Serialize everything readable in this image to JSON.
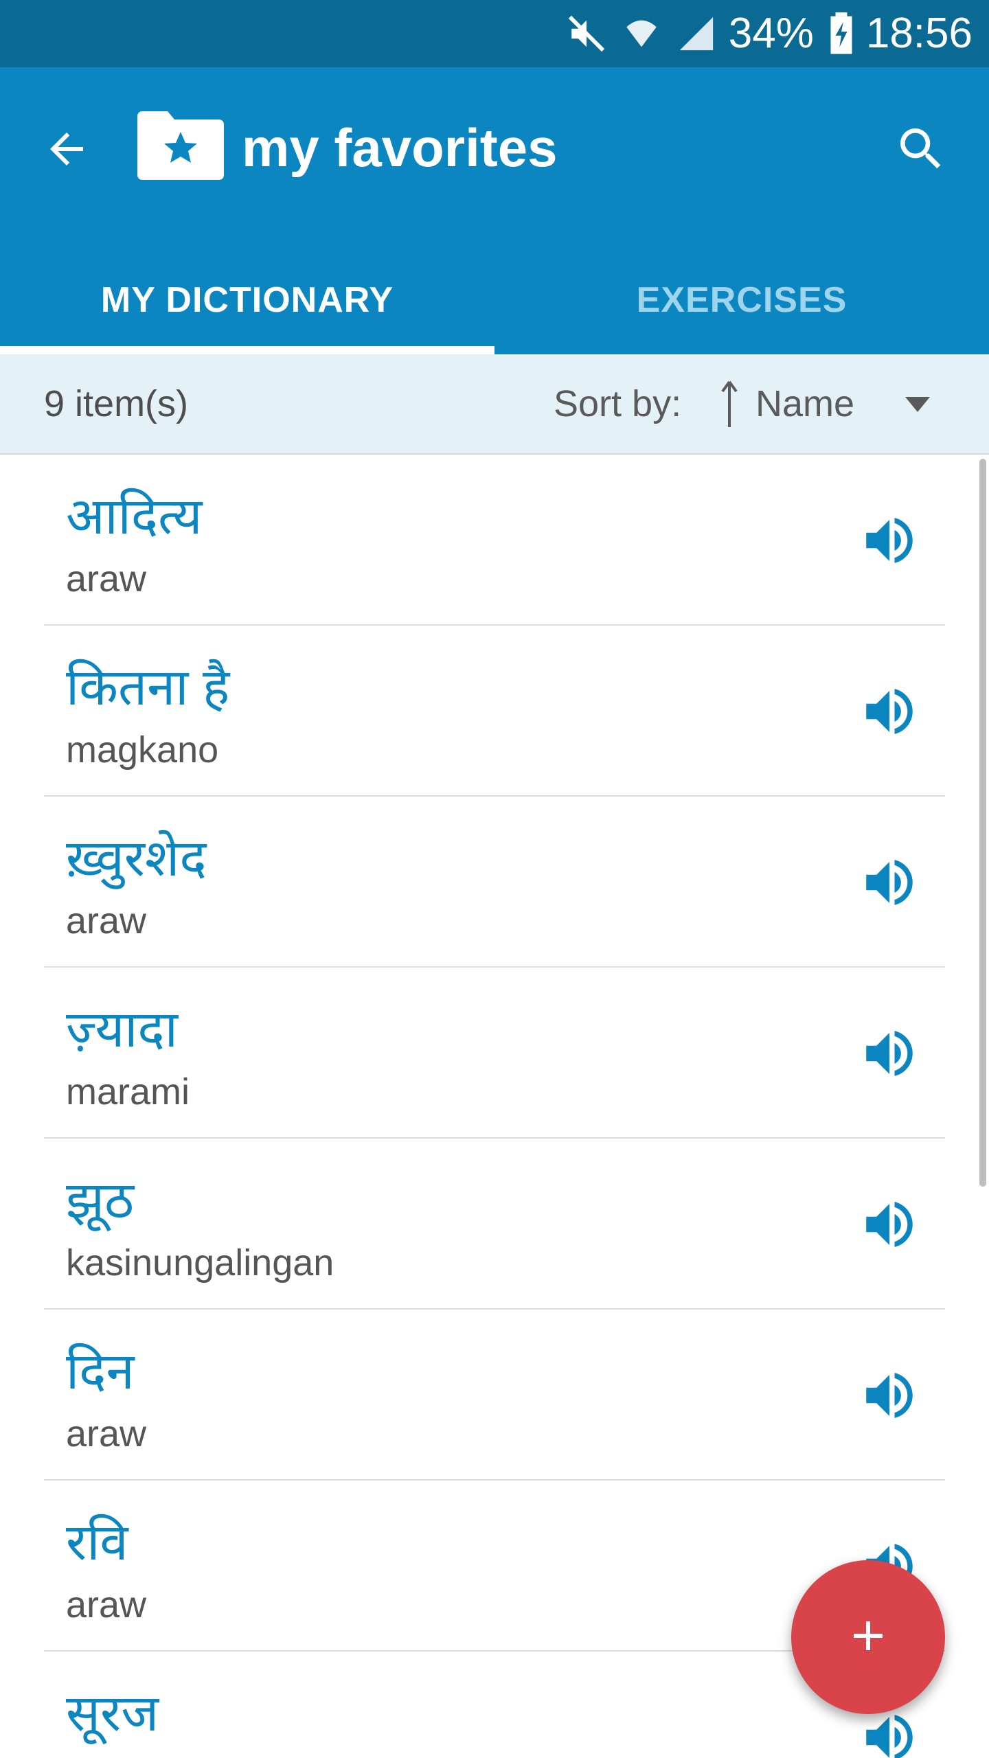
{
  "status_bar": {
    "battery_percent": "34%",
    "time": "18:56",
    "icons": [
      "mute-icon",
      "wifi-icon",
      "signal-icon",
      "battery-charging-icon"
    ]
  },
  "app_bar": {
    "title": "my favorites",
    "icons": {
      "back": "arrow-back-icon",
      "folder": "star-folder-icon",
      "search": "search-icon"
    }
  },
  "tabs": [
    {
      "label": "MY DICTIONARY",
      "active": true
    },
    {
      "label": "EXERCISES",
      "active": false
    }
  ],
  "sort_bar": {
    "count_label": "9 item(s)",
    "sort_label": "Sort by:",
    "sort_value": "Name"
  },
  "items": [
    {
      "word": "आदित्य",
      "translation": "araw"
    },
    {
      "word": "कितना है",
      "translation": "magkano"
    },
    {
      "word": "ख़्वुरशेद",
      "translation": "araw"
    },
    {
      "word": "ज़्यादा",
      "translation": "marami"
    },
    {
      "word": "झूठ",
      "translation": "kasinungalingan"
    },
    {
      "word": "दिन",
      "translation": "araw"
    },
    {
      "word": "रवि",
      "translation": "araw"
    },
    {
      "word": "सूरज",
      "translation": ""
    }
  ],
  "colors": {
    "status_bar": "#0a6a93",
    "app_bar": "#0b86c0",
    "accent_text": "#0b86c0",
    "fab": "#d9434a",
    "sort_bar": "#e4f1f7"
  }
}
